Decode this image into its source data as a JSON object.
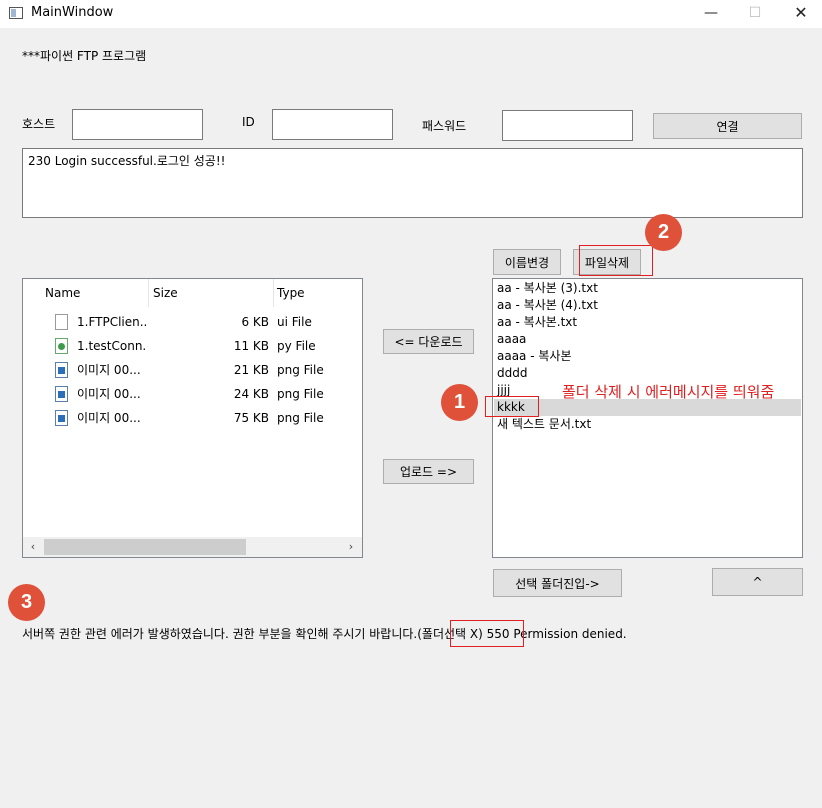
{
  "window": {
    "title": "MainWindow",
    "minimize": "—",
    "maximize": "☐",
    "close": "✕"
  },
  "program_label": "***파이썬 FTP 프로그램",
  "connection": {
    "host_label": "호스트",
    "host_value": "",
    "id_label": "ID",
    "id_value": "",
    "password_label": "패스워드",
    "password_value": "",
    "connect_button": "연결"
  },
  "log": {
    "text": "230 Login successful.로그인 성공!!"
  },
  "local": {
    "columns": [
      "Name",
      "Size",
      "Type"
    ],
    "files": [
      {
        "name": "1.FTPClien...",
        "size": "6 KB",
        "type": "ui File",
        "icon": "file-icon"
      },
      {
        "name": "1.testConn...",
        "size": "11 KB",
        "type": "py File",
        "icon": "python-file-icon"
      },
      {
        "name": "이미지 00...",
        "size": "21 KB",
        "type": "png File",
        "icon": "image-file-icon"
      },
      {
        "name": "이미지 00...",
        "size": "24 KB",
        "type": "png File",
        "icon": "image-file-icon"
      },
      {
        "name": "이미지 00...",
        "size": "75 KB",
        "type": "png File",
        "icon": "image-file-icon"
      }
    ],
    "scroll_left": "‹",
    "scroll_right": "›"
  },
  "transfer": {
    "download_button": "<= 다운로드",
    "upload_button": "업로드 =>"
  },
  "remote": {
    "rename_button": "이름변경",
    "delete_button": "파일삭제",
    "items": [
      "aa - 복사본 (3).txt",
      "aa - 복사본 (4).txt",
      "aa - 복사본.txt",
      "aaaa",
      "aaaa - 복사본",
      "dddd",
      "jjjj",
      "kkkk",
      "새 텍스트 문서.txt"
    ],
    "selected_index": 7,
    "enter_folder_button": "선택 폴더진입->",
    "up_button": "^"
  },
  "status": {
    "text": "서버쪽 권한 관련 에러가 발생하였습니다. 권한 부분을 확인해 주시기 바랍니다.(폴더선택 X) 550 Permission denied."
  },
  "annotations": {
    "badge_1": "1",
    "badge_2": "2",
    "badge_3": "3",
    "note_1": "폴더 삭제 시 에러메시지를 띄워줌",
    "accent_color": "#e0513a",
    "box_color": "#e02020"
  }
}
